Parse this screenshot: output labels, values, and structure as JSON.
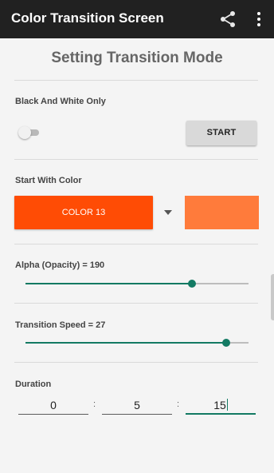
{
  "colors": {
    "appbar": "#212121",
    "accent": "#137a63",
    "color_button": "#ff4c05",
    "color_preview": "#ff7b3b"
  },
  "appbar": {
    "title": "Color Transition Screen",
    "share_icon": "share-icon",
    "more_icon": "more-vert-icon"
  },
  "page": {
    "title": "Setting Transition Mode"
  },
  "black_white": {
    "label": "Black And White Only",
    "enabled": false,
    "start_label": "START"
  },
  "start_color": {
    "label": "Start With Color",
    "selected": "COLOR 13"
  },
  "alpha": {
    "label": "Alpha (Opacity) = 190",
    "value": 190,
    "max": 255
  },
  "speed": {
    "label": "Transition Speed = 27",
    "value": 27,
    "max": 30
  },
  "duration": {
    "label": "Duration",
    "hours": "0",
    "minutes": "5",
    "seconds": "15",
    "separator": ":"
  }
}
